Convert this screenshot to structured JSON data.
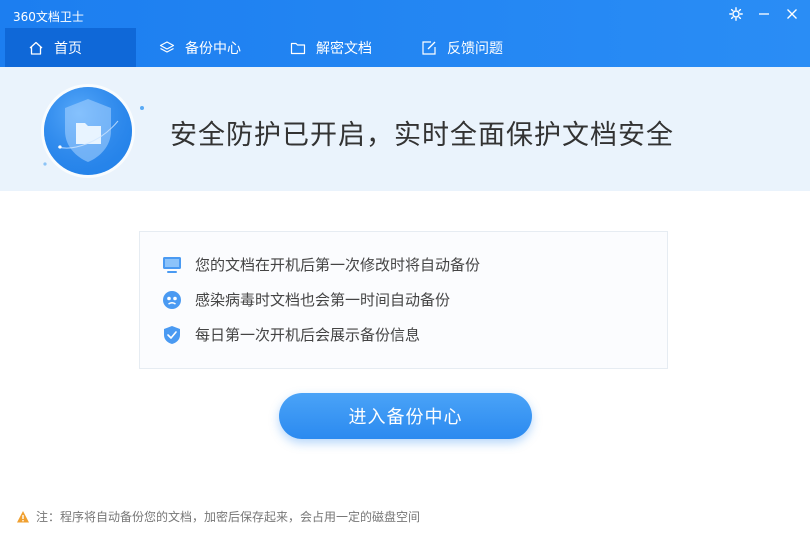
{
  "app": {
    "title": "360文档卫士"
  },
  "window": {
    "settings_icon": "gear-icon",
    "minimize_icon": "minimize-icon",
    "close_icon": "close-icon"
  },
  "tabs": [
    {
      "label": "首页",
      "icon": "home-icon",
      "active": true
    },
    {
      "label": "备份中心",
      "icon": "layers-icon",
      "active": false
    },
    {
      "label": "解密文档",
      "icon": "folder-icon",
      "active": false
    },
    {
      "label": "反馈问题",
      "icon": "edit-icon",
      "active": false
    }
  ],
  "banner": {
    "status_text": "安全防护已开启，实时全面保护文档安全"
  },
  "features": [
    {
      "text": "您的文档在开机后第一次修改时将自动备份",
      "icon": "monitor-icon"
    },
    {
      "text": "感染病毒时文档也会第一时间自动备份",
      "icon": "virus-icon"
    },
    {
      "text": "每日第一次开机后会展示备份信息",
      "icon": "shield-check-icon"
    }
  ],
  "actions": {
    "primary_label": "进入备份中心"
  },
  "footer": {
    "note": "注：程序将自动备份您的文档，加密后保存起来，会占用一定的磁盘空间"
  },
  "colors": {
    "brand": "#1c7ef0",
    "active_tab": "#0f68d8",
    "banner_bg": "#eaf3fc",
    "button": "#2b8af0",
    "warning": "#f0a030"
  }
}
